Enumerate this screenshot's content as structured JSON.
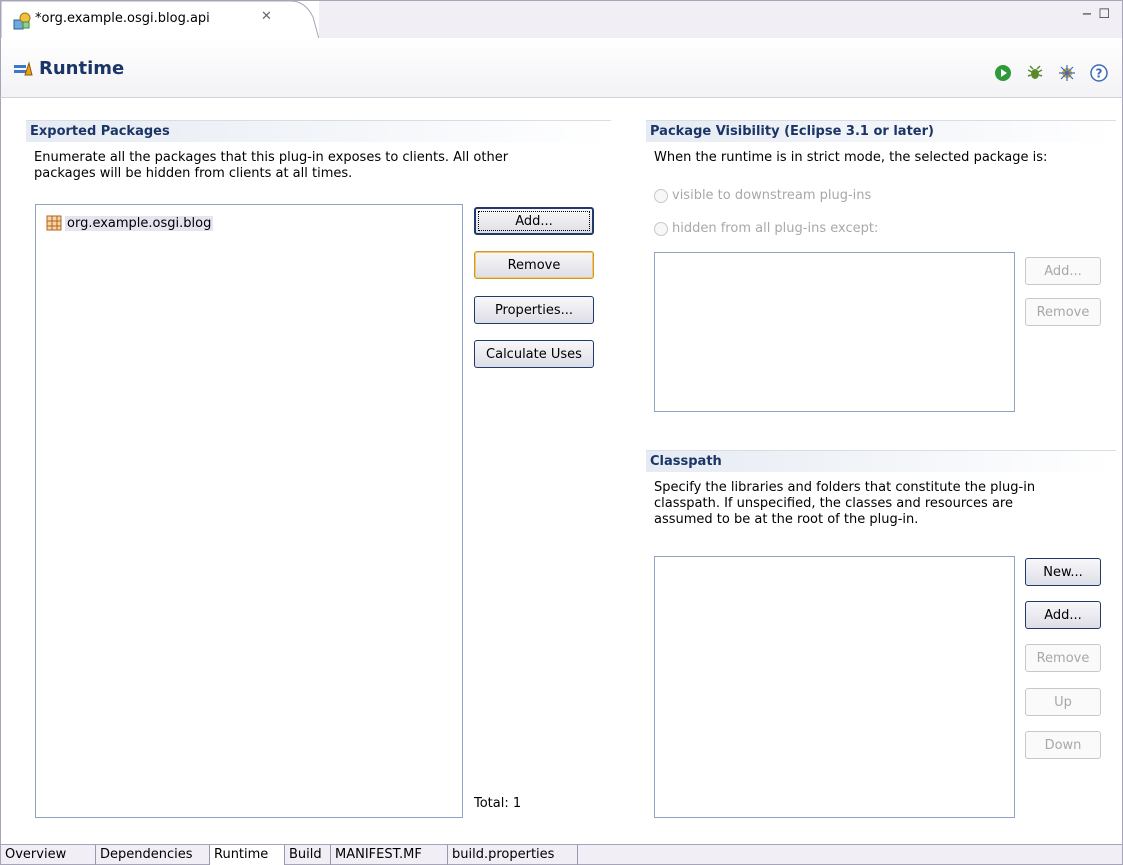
{
  "editor_tab": {
    "title": "*org.example.osgi.blog.api",
    "close_glyph": "✕"
  },
  "window_buttons": {
    "minimize": "−",
    "maximize": "☐"
  },
  "header": {
    "title": "Runtime",
    "tools": [
      "run-icon",
      "debug-icon",
      "profile-icon",
      "help-icon"
    ]
  },
  "exported_packages": {
    "title": "Exported Packages",
    "description_line1": "Enumerate all the packages that this plug-in exposes to clients.  All other",
    "description_line2": "packages will be hidden from clients at all times.",
    "items": [
      "org.example.osgi.blog"
    ],
    "buttons": {
      "add": "Add...",
      "remove": "Remove",
      "properties": "Properties...",
      "calculate_uses": "Calculate Uses"
    },
    "total_label": "Total: 1"
  },
  "package_visibility": {
    "title": "Package Visibility (Eclipse 3.1 or later)",
    "description": "When the runtime is in strict mode, the selected package is:",
    "option_visible": "visible to downstream plug-ins",
    "option_hidden": "hidden from all plug-ins except:",
    "buttons": {
      "add": "Add...",
      "remove": "Remove"
    }
  },
  "classpath": {
    "title": "Classpath",
    "description_line1": "Specify the libraries and folders that constitute the plug-in",
    "description_line2": "classpath.  If unspecified, the classes and resources are",
    "description_line3": "assumed to be at the root of the plug-in.",
    "buttons": {
      "new": "New...",
      "add": "Add...",
      "remove": "Remove",
      "up": "Up",
      "down": "Down"
    }
  },
  "page_tabs": [
    "Overview",
    "Dependencies",
    "Runtime",
    "Build",
    "MANIFEST.MF",
    "build.properties"
  ],
  "active_tab": "Runtime",
  "colors": {
    "section_title": "#1b3566",
    "frame": "#a8a4b8",
    "list_border": "#8ea3c2"
  }
}
